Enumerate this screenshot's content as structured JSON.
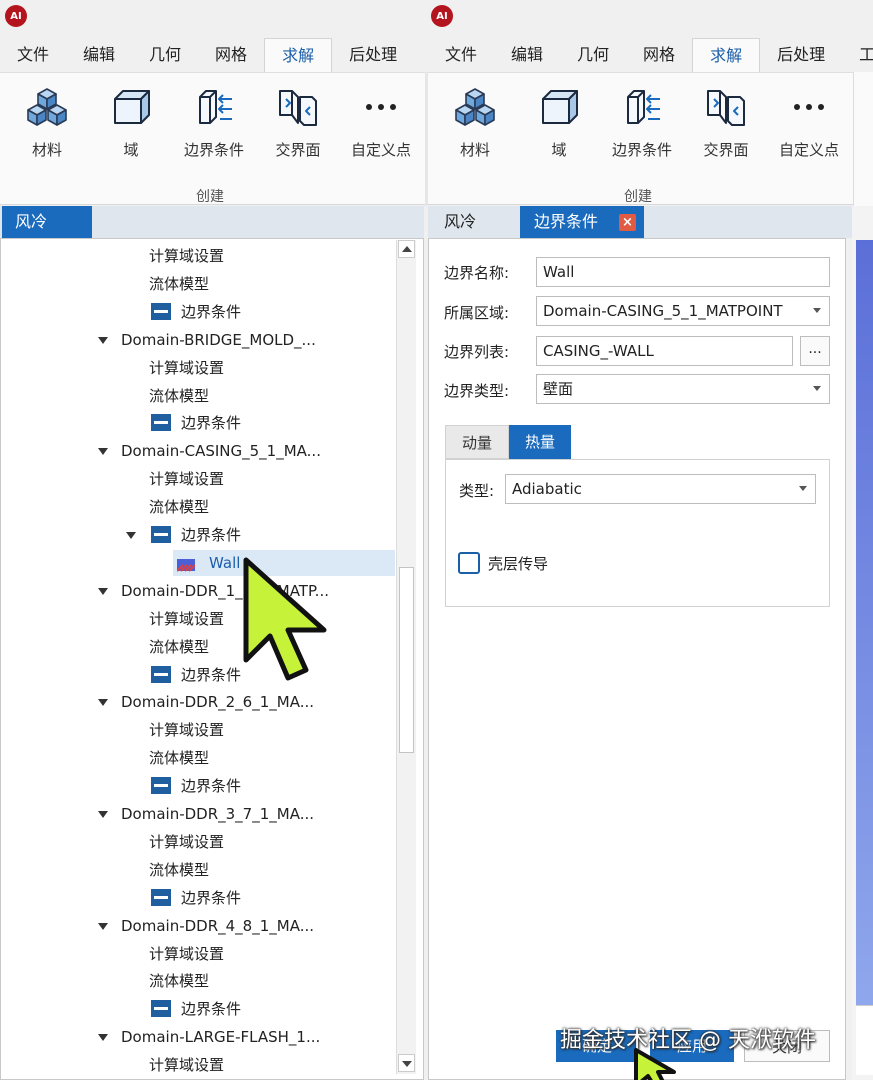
{
  "app": {
    "logo_text": "AI"
  },
  "menu": {
    "items": [
      "文件",
      "编辑",
      "几何",
      "网格",
      "求解",
      "后处理"
    ],
    "active_index": 4,
    "extra_item": "工"
  },
  "ribbon": {
    "tools": [
      {
        "label": "材料",
        "icon": "material-cubes-icon"
      },
      {
        "label": "域",
        "icon": "domain-box-icon"
      },
      {
        "label": "边界条件",
        "icon": "boundary-condition-icon"
      },
      {
        "label": "交界面",
        "icon": "interface-icon"
      },
      {
        "label": "自定义点",
        "icon": "more-dots-icon"
      }
    ],
    "group_label": "创建"
  },
  "left_panel": {
    "tab": "风冷",
    "tree": [
      {
        "type": "child",
        "text": "计算域设置"
      },
      {
        "type": "child",
        "text": "流体模型"
      },
      {
        "type": "bc",
        "text": "边界条件"
      },
      {
        "type": "domain",
        "text": "Domain-BRIDGE_MOLD_..."
      },
      {
        "type": "child",
        "text": "计算域设置"
      },
      {
        "type": "child",
        "text": "流体模型"
      },
      {
        "type": "bc",
        "text": "边界条件"
      },
      {
        "type": "domain",
        "text": "Domain-CASING_5_1_MA..."
      },
      {
        "type": "child",
        "text": "计算域设置"
      },
      {
        "type": "child",
        "text": "流体模型"
      },
      {
        "type": "bc-open",
        "text": "边界条件"
      },
      {
        "type": "wall",
        "text": "Wall"
      },
      {
        "type": "domain",
        "text": "Domain-DDR_1_3_1_MATP..."
      },
      {
        "type": "child",
        "text": "计算域设置"
      },
      {
        "type": "child",
        "text": "流体模型"
      },
      {
        "type": "bc",
        "text": "边界条件"
      },
      {
        "type": "domain",
        "text": "Domain-DDR_2_6_1_MA..."
      },
      {
        "type": "child",
        "text": "计算域设置"
      },
      {
        "type": "child",
        "text": "流体模型"
      },
      {
        "type": "bc",
        "text": "边界条件"
      },
      {
        "type": "domain",
        "text": "Domain-DDR_3_7_1_MA..."
      },
      {
        "type": "child",
        "text": "计算域设置"
      },
      {
        "type": "child",
        "text": "流体模型"
      },
      {
        "type": "bc",
        "text": "边界条件"
      },
      {
        "type": "domain",
        "text": "Domain-DDR_4_8_1_MA..."
      },
      {
        "type": "child",
        "text": "计算域设置"
      },
      {
        "type": "child",
        "text": "流体模型"
      },
      {
        "type": "bc",
        "text": "边界条件"
      },
      {
        "type": "domain",
        "text": "Domain-LARGE-FLASH_1..."
      },
      {
        "type": "child",
        "text": "计算域设置"
      }
    ]
  },
  "right_panel": {
    "tabs": {
      "tab1": "风冷",
      "tab2": "边界条件",
      "close": "×"
    },
    "form": {
      "name_label": "边界名称:",
      "name_value": "Wall",
      "region_label": "所属区域:",
      "region_value": "Domain-CASING_5_1_MATPOINT",
      "list_label": "边界列表:",
      "list_value": "CASING_-WALL",
      "list_btn": "...",
      "type_label": "边界类型:",
      "type_value": "壁面"
    },
    "subtabs": {
      "momentum": "动量",
      "heat": "热量"
    },
    "heat": {
      "type_label": "类型:",
      "type_value": "Adiabatic",
      "shell_label": "壳层传导"
    }
  },
  "buttons": {
    "ok": "确定",
    "apply": "应用",
    "close": "关闭"
  },
  "watermark": "掘金技术社区 @ 天洑软件",
  "colors": {
    "accent": "#1a6bbd",
    "cursor": "#c6f23a"
  }
}
